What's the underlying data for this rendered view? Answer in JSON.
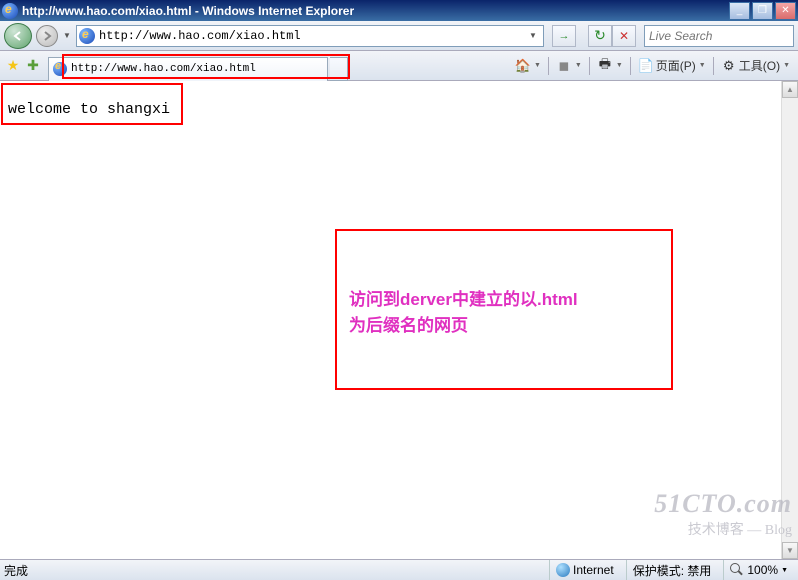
{
  "titlebar": {
    "title": "http://www.hao.com/xiao.html - Windows Internet Explorer"
  },
  "nav": {
    "url": "http://www.hao.com/xiao.html",
    "search_placeholder": "Live Search"
  },
  "tab": {
    "title": "http://www.hao.com/xiao.html"
  },
  "toolbar": {
    "page": "页面(P)",
    "tools": "工具(O)"
  },
  "page": {
    "body_text": "welcome to shangxi"
  },
  "annotation": {
    "line1": "访问到derver中建立的以.html",
    "line2": "为后缀名的网页"
  },
  "status": {
    "done": "完成",
    "zone": "Internet",
    "protected": "保护模式: 禁用",
    "zoom": "100%"
  },
  "watermark": {
    "big": "51CTO.com",
    "small": "技术博客 — Blog"
  }
}
